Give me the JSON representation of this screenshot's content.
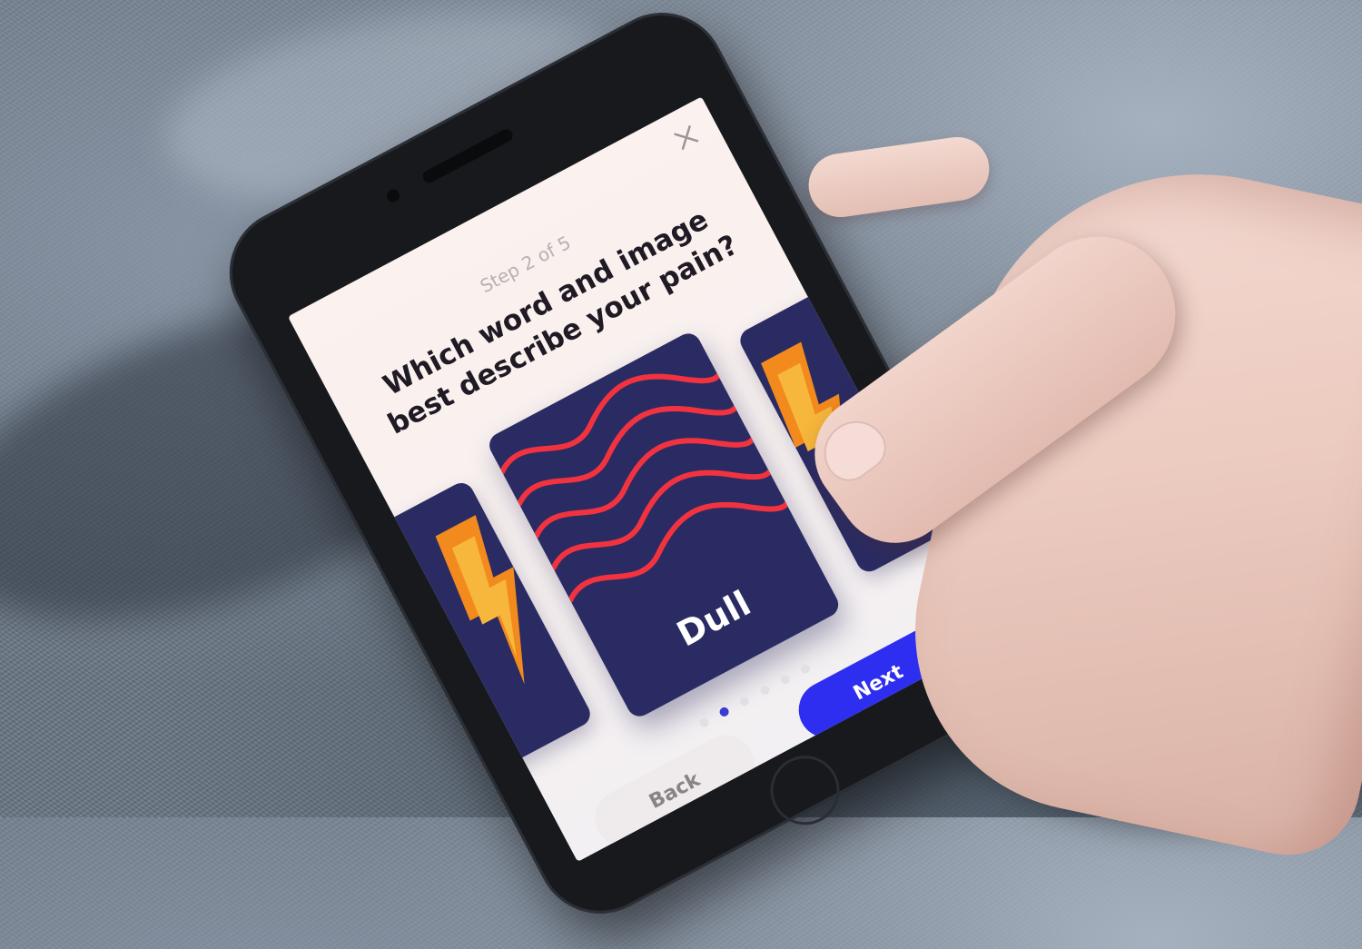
{
  "app": {
    "step_label": "Step 2 of 5",
    "question_line1": "Which word and image",
    "question_line2": "best describe your pain?",
    "close_icon": "close-icon"
  },
  "cards": [
    {
      "label": "",
      "icon": "lightning-bolt-icon",
      "position": "left"
    },
    {
      "label": "Dull",
      "icon": "wavy-lines-icon",
      "position": "center"
    },
    {
      "label": "",
      "icon": "lightning-bolt-icon",
      "position": "right"
    }
  ],
  "pagination": {
    "total": 6,
    "active_index": 1
  },
  "buttons": {
    "back_label": "Back",
    "next_label": "Next"
  },
  "colors": {
    "card_background": "#2a2b63",
    "wave_color": "#f2333f",
    "primary_button": "#2e2ef0",
    "secondary_button": "#efeaec",
    "bolt_color": "#f28a1e"
  }
}
